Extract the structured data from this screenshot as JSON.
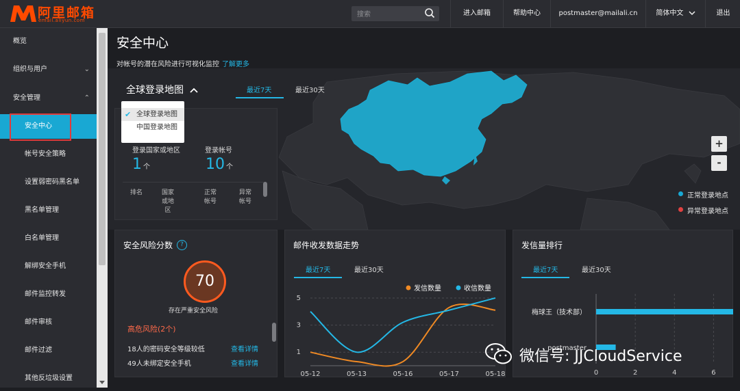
{
  "logo": {
    "name": "阿里邮箱",
    "sub": "email.aliyun.com"
  },
  "search": {
    "placeholder": "搜索"
  },
  "topnav": {
    "enter_mail": "进入邮箱",
    "help": "帮助中心",
    "user": "postmaster@mailali.cn",
    "language": "简体中文",
    "logout": "退出"
  },
  "sidebar": {
    "items": [
      {
        "label": "概览"
      },
      {
        "label": "组织与用户"
      },
      {
        "label": "安全管理"
      },
      {
        "label": "安全中心"
      },
      {
        "label": "帐号安全策略"
      },
      {
        "label": "设置弱密码黑名单"
      },
      {
        "label": "黑名单管理"
      },
      {
        "label": "白名单管理"
      },
      {
        "label": "解绑安全手机"
      },
      {
        "label": "邮件监控转发"
      },
      {
        "label": "邮件审核"
      },
      {
        "label": "邮件过滤"
      },
      {
        "label": "其他反垃圾设置"
      }
    ]
  },
  "page": {
    "title": "安全中心",
    "desc": "对帐号的潜在风险进行可视化监控",
    "learn_more": "了解更多"
  },
  "map": {
    "title": "全球登录地图",
    "tabs": [
      "最近7天",
      "最近30天"
    ],
    "dropdown": [
      "全球登录地图",
      "中国登录地图"
    ],
    "stats": [
      {
        "label": "登录国家或地区",
        "value": "1",
        "unit": "个"
      },
      {
        "label": "登录帐号",
        "value": "10",
        "unit": "个"
      }
    ],
    "table_headers": [
      "排名",
      "国家或地区",
      "正常帐号",
      "异常帐号"
    ],
    "zoom_in": "+",
    "zoom_out": "-",
    "legend": [
      {
        "label": "正常登录地点",
        "color": "#19a8d3"
      },
      {
        "label": "异常登录地点",
        "color": "#e04141"
      }
    ]
  },
  "risk": {
    "title": "安全风险分数",
    "help": "?",
    "score": "70",
    "score_caption": "存在严重安全风险",
    "high_risk": "高危风险(2个)",
    "items": [
      {
        "text": "18人的密码安全等级较低",
        "action": "查看详情"
      },
      {
        "text": "49人未绑定安全手机",
        "action": "查看详情"
      }
    ]
  },
  "trend": {
    "title": "邮件收发数据走势",
    "tabs": [
      "最近7天",
      "最近30天"
    ]
  },
  "ranking": {
    "title": "发信量排行",
    "tabs": [
      "最近7天",
      "最近30天"
    ]
  },
  "watermark": {
    "text": "微信号: JJCloudService"
  },
  "chart_data": [
    {
      "type": "line",
      "title": "",
      "x": [
        "05-12",
        "05-13",
        "05-16",
        "05-17",
        "05-18"
      ],
      "series": [
        {
          "name": "发信数量",
          "color": "#f08a24",
          "values": [
            1.0,
            0.3,
            0.3,
            4.3,
            4.1
          ]
        },
        {
          "name": "收信数量",
          "color": "#24b8e6",
          "values": [
            4.0,
            1.0,
            3.2,
            4.1,
            5.0
          ]
        }
      ],
      "yticks": [
        1,
        3,
        5
      ],
      "ylim": [
        0,
        5.3
      ],
      "legend": "top-right",
      "grid": true
    },
    {
      "type": "bar",
      "orientation": "horizontal",
      "title": "",
      "categories": [
        "梅球王（技术部）",
        "postmaster"
      ],
      "values": [
        7,
        1
      ],
      "xticks": [
        0,
        2,
        4,
        6
      ],
      "xlim": [
        0,
        7
      ],
      "color": "#24b8e6",
      "grid": true
    }
  ]
}
